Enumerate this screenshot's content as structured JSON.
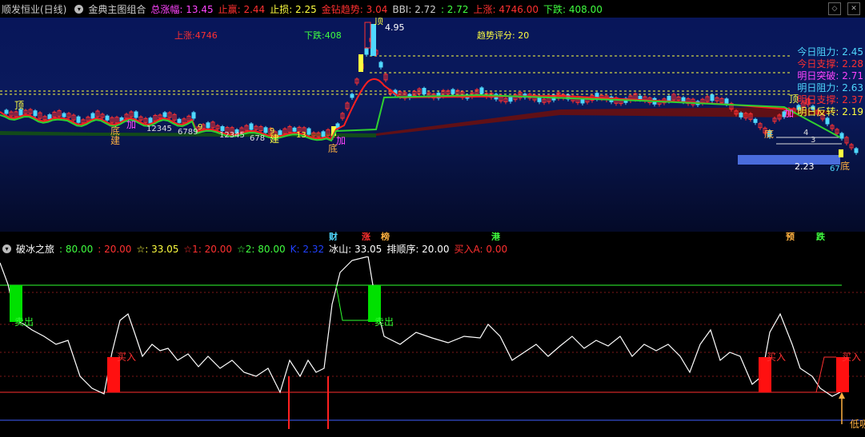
{
  "header": {
    "stock": "顺发恒业(日线)",
    "indicator": "金典主图组合",
    "fields": [
      {
        "label": "总涨幅:",
        "value": "13.45",
        "color": "#ff44ff"
      },
      {
        "label": "止赢:",
        "value": "2.44",
        "color": "#ff3030"
      },
      {
        "label": "止损:",
        "value": "2.25",
        "color": "#ffff40"
      },
      {
        "label": "金钻趋势:",
        "value": "3.04",
        "color": "#ff3030"
      },
      {
        "label": "BBI:",
        "value": "2.72",
        "color": "#cccccc"
      },
      {
        "label": ":",
        "value": "2.72",
        "color": "#40ff40"
      },
      {
        "label": "上涨:",
        "value": "4746.00",
        "color": "#ff3030"
      },
      {
        "label": "下跌:",
        "value": "408.00",
        "color": "#40ff40"
      }
    ]
  },
  "main_chart": {
    "rise_label": "上涨:4746",
    "fall_label": "下跌:408",
    "score_label": "趋势评分:",
    "score_value": "20",
    "high_price": "4.95",
    "low_price": "2.23",
    "legend": [
      {
        "label": "今日阻力:",
        "value": "2.45",
        "color": "#4fd8ff"
      },
      {
        "label": "今日支撑:",
        "value": "2.28",
        "color": "#ff3030"
      },
      {
        "label": "明日突破:",
        "value": "2.71",
        "color": "#ff44ff"
      },
      {
        "label": "明日阻力:",
        "value": "2.63",
        "color": "#4fd8ff"
      },
      {
        "label": "明日支撑:",
        "value": "2.37",
        "color": "#ff3030"
      },
      {
        "label": "明日反转:",
        "value": "2.19",
        "color": "#ffff40"
      }
    ],
    "markers": {
      "top": "顶",
      "bottom": "底",
      "add": "加",
      "jian": "建",
      "count_seq1": "12345",
      "count_seq2": "6789",
      "count_seq3": "12345",
      "count_seq4": "678",
      "count_num": "13",
      "num_9": "9",
      "num_67": "67",
      "num_3": "3",
      "num_4": "4"
    },
    "events": [
      {
        "label": "财",
        "color": "#4fd8ff"
      },
      {
        "label": "涨",
        "color": "#ff3030"
      },
      {
        "label": "榜",
        "color": "#ffb040"
      },
      {
        "label": "港",
        "color": "#40ff40"
      },
      {
        "label": "预",
        "color": "#ffb040"
      },
      {
        "label": "跌",
        "color": "#40ff40"
      }
    ]
  },
  "sub_chart": {
    "name": "破冰之旅",
    "fields": [
      {
        "label": ":",
        "value": "80.00",
        "color": "#40ff40"
      },
      {
        "label": ":",
        "value": "20.00",
        "color": "#ff3030"
      },
      {
        "label": "☆:",
        "value": "33.05",
        "color": "#ffff40"
      },
      {
        "label": "☆1:",
        "value": "20.00",
        "color": "#ff3030"
      },
      {
        "label": "☆2:",
        "value": "80.00",
        "color": "#40ff40"
      },
      {
        "label": "K:",
        "value": "2.32",
        "color": "#2040ff"
      },
      {
        "label": "冰山:",
        "value": "33.05",
        "color": "#ffffff"
      },
      {
        "label": "排顺序:",
        "value": "20.00",
        "color": "#ffffff"
      },
      {
        "label": "买入A:",
        "value": "0.00",
        "color": "#ff3030"
      }
    ],
    "sell_label": "卖出",
    "buy_label": "买入",
    "low_label": "低吸"
  }
}
